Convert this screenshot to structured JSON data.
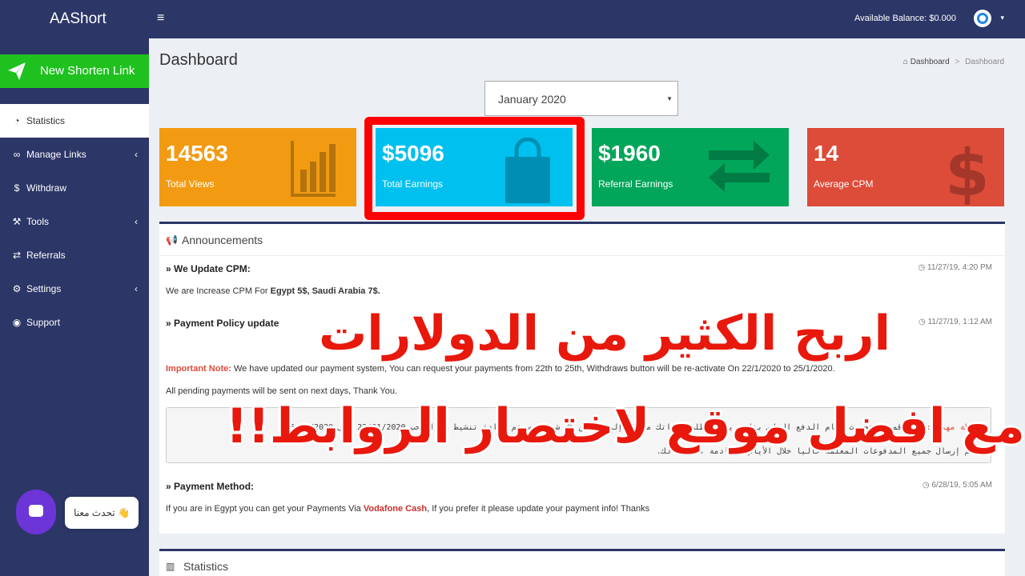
{
  "topbar": {
    "logo": "AAShort",
    "menu_toggle": "≡",
    "balance": "Available Balance: $0.000",
    "caret": "▾"
  },
  "sidebar": {
    "new_link": "New Shorten Link",
    "items": [
      {
        "label": "Statistics",
        "icon": "dashboard-icon"
      },
      {
        "label": "Manage Links",
        "icon": "link-icon"
      },
      {
        "label": "Withdraw",
        "icon": "dollar-icon"
      },
      {
        "label": "Tools",
        "icon": "wrench-icon"
      },
      {
        "label": "Referrals",
        "icon": "exchange-icon"
      },
      {
        "label": "Settings",
        "icon": "cogs-icon"
      },
      {
        "label": "Support",
        "icon": "life-ring-icon"
      }
    ],
    "chev": "‹"
  },
  "chat": {
    "label": "تحدث معنا 👋"
  },
  "page": {
    "title": "Dashboard",
    "breadcrumb": [
      "Dashboard",
      "Dashboard"
    ]
  },
  "month": {
    "value": "January 2020",
    "caret": "▼"
  },
  "stats": [
    {
      "value": "14563",
      "label": "Total Views",
      "color": "#f29b12",
      "icon": "bar-chart-icon"
    },
    {
      "value": "$5096",
      "label": "Total Earnings",
      "color": "#00c0ef",
      "icon": "shopping-bag-icon"
    },
    {
      "value": "$1960",
      "label": "Referral Earnings",
      "color": "#01a65a",
      "icon": "exchange-icon"
    },
    {
      "value": "14",
      "label": "Average CPM",
      "color": "#dd4b39",
      "icon": "dollar-icon"
    }
  ],
  "announcements": {
    "title": "Announcements",
    "items": [
      {
        "title": "We Update CPM:",
        "time": "11/27/19, 4:20 PM",
        "text_pre": "We are Increase CPM For ",
        "text_bold": "Egypt 5$, Saudi Arabia 7$."
      },
      {
        "title": "Payment Policy update",
        "time": "11/27/19, 1:12 AM",
        "note_label": "Important Note:",
        "note_text": " We have updated our payment system, You can request your payments from 22th to 25th, Withdraws button will be re-activate On 22/1/2020 to 25/1/2020.",
        "text2": "All pending payments will be sent on next days, Thank You.",
        "arabic_label": "ملاحظة مهمة :",
        "arabic_line1": "لقد قمنا بتحديث نظام الدفع الخاص بنا ، يمكنك طلب دفعاتك من 22 إلى 25 من كل شهر ، سيتم إعادة تنشيط زر السحب 22/01/2020 إلى 25/01/2020",
        "arabic_line2": "سيتم إرسال جميع المدفوعات المعلقة حاليا خلال الأيام القادمة ، شكرا لك."
      },
      {
        "title": "Payment Method:",
        "time": "6/28/19, 5:05 AM",
        "text_pre": "If you are in Egypt you can get your Payments Via ",
        "text_bold": "Vodafone Cash",
        "text_post": ", If you prefer it please update your payment info! Thanks"
      }
    ]
  },
  "statistics_panel": {
    "title": "Statistics"
  },
  "overlay": {
    "line1": "اربح الكثير من الدولارات",
    "line2": "مع افضل موقع لاختصار الروابط!!"
  }
}
